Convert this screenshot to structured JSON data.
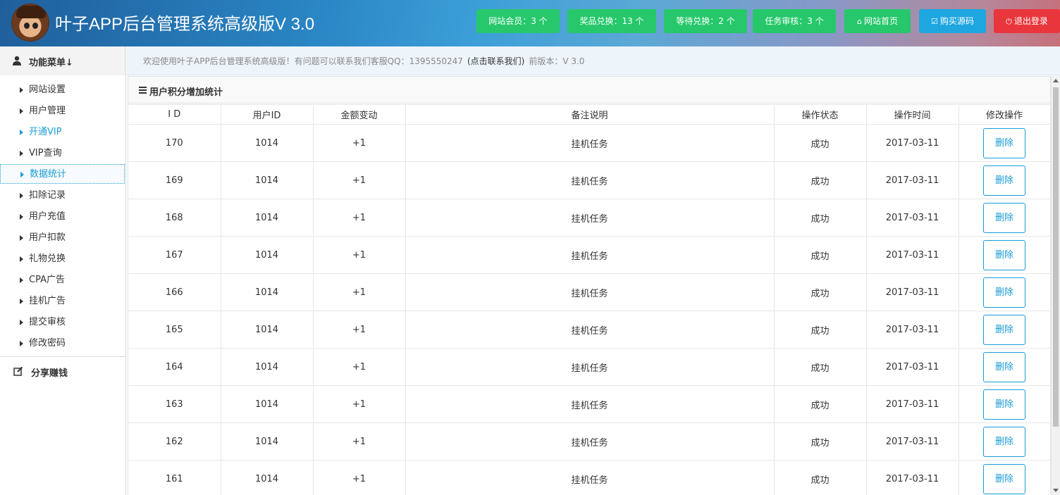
{
  "header": {
    "title": "叶子APP后台管理系统高级版V 3.0",
    "avatar_icon": "cartoon-boy-avatar",
    "buttons": [
      {
        "label": "网站会员：3 个",
        "color": "#27c86c",
        "kind": "stat"
      },
      {
        "label": "奖品兑换：13 个",
        "color": "#27c86c",
        "kind": "stat"
      },
      {
        "label": "等待兑换：2 个",
        "color": "#27c86c",
        "kind": "stat"
      },
      {
        "label": "任务审核：3 个",
        "color": "#27c86c",
        "kind": "stat"
      },
      {
        "label": "网站首页",
        "color": "#27c86c",
        "icon": "home-icon"
      },
      {
        "label": "购买源码",
        "color": "#1ea6e0",
        "icon": "checkbox-icon"
      },
      {
        "label": "退出登录",
        "color": "#e8363c",
        "icon": "power-icon"
      }
    ]
  },
  "subbar": {
    "menu_title": "功能菜单↓",
    "welcome": "欢迎使用叶子APP后台管理系统高级版！有问题可以联系我们客服QQ：1395550247",
    "contact_link": "(点击联系我们)",
    "version": "前版本：V 3.0"
  },
  "sidebar": {
    "items": [
      {
        "label": "网站设置"
      },
      {
        "label": "用户管理"
      },
      {
        "label": "开通VIP",
        "active": true
      },
      {
        "label": "VIP查询"
      },
      {
        "label": "数据统计",
        "active": true,
        "selected": true
      },
      {
        "label": "扣除记录"
      },
      {
        "label": "用户充值"
      },
      {
        "label": "用户扣款"
      },
      {
        "label": "礼物兑换"
      },
      {
        "label": "CPA广告"
      },
      {
        "label": "挂机广告"
      },
      {
        "label": "提交审核"
      },
      {
        "label": "修改密码"
      }
    ],
    "share_label": "分享赚钱"
  },
  "panel": {
    "title": "用户积分增加统计",
    "columns": [
      "I D",
      "用户ID",
      "金额变动",
      "备注说明",
      "操作状态",
      "操作时间",
      "修改操作"
    ],
    "delete_label": "删除",
    "rows": [
      {
        "id": "170",
        "user_id": "1014",
        "change": "+1",
        "note": "挂机任务",
        "status": "成功",
        "time": "2017-03-11"
      },
      {
        "id": "169",
        "user_id": "1014",
        "change": "+1",
        "note": "挂机任务",
        "status": "成功",
        "time": "2017-03-11"
      },
      {
        "id": "168",
        "user_id": "1014",
        "change": "+1",
        "note": "挂机任务",
        "status": "成功",
        "time": "2017-03-11"
      },
      {
        "id": "167",
        "user_id": "1014",
        "change": "+1",
        "note": "挂机任务",
        "status": "成功",
        "time": "2017-03-11"
      },
      {
        "id": "166",
        "user_id": "1014",
        "change": "+1",
        "note": "挂机任务",
        "status": "成功",
        "time": "2017-03-11"
      },
      {
        "id": "165",
        "user_id": "1014",
        "change": "+1",
        "note": "挂机任务",
        "status": "成功",
        "time": "2017-03-11"
      },
      {
        "id": "164",
        "user_id": "1014",
        "change": "+1",
        "note": "挂机任务",
        "status": "成功",
        "time": "2017-03-11"
      },
      {
        "id": "163",
        "user_id": "1014",
        "change": "+1",
        "note": "挂机任务",
        "status": "成功",
        "time": "2017-03-11"
      },
      {
        "id": "162",
        "user_id": "1014",
        "change": "+1",
        "note": "挂机任务",
        "status": "成功",
        "time": "2017-03-11"
      },
      {
        "id": "161",
        "user_id": "1014",
        "change": "+1",
        "note": "挂机任务",
        "status": "成功",
        "time": "2017-03-11"
      }
    ]
  }
}
